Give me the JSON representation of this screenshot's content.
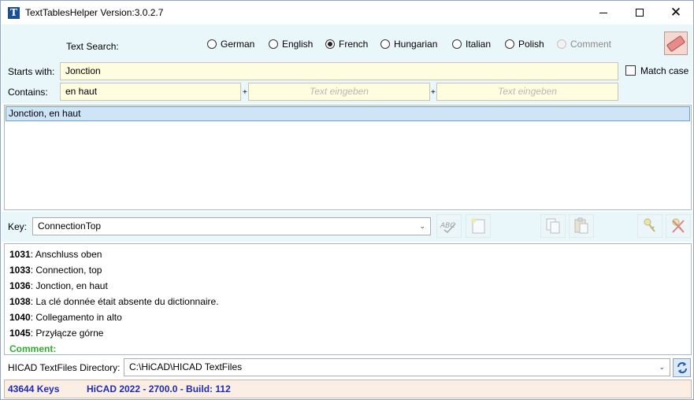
{
  "window": {
    "title": "TextTablesHelper Version:3.0.2.7",
    "app_icon_letter": "T"
  },
  "search": {
    "label": "Text Search:",
    "languages": [
      {
        "label": "German",
        "selected": false,
        "enabled": true
      },
      {
        "label": "English",
        "selected": false,
        "enabled": true
      },
      {
        "label": "French",
        "selected": true,
        "enabled": true
      },
      {
        "label": "Hungarian",
        "selected": false,
        "enabled": true
      },
      {
        "label": "Italian",
        "selected": false,
        "enabled": true
      },
      {
        "label": "Polish",
        "selected": false,
        "enabled": true
      },
      {
        "label": "Comment",
        "selected": false,
        "enabled": false
      }
    ],
    "starts_with_label": "Starts with:",
    "starts_with_value": "Jonction",
    "contains_label": "Contains:",
    "contains_value": "en haut",
    "plus": "+",
    "extra_placeholder_1": "Text eingeben",
    "extra_placeholder_2": "Text eingeben",
    "match_case_label": "Match case",
    "match_case_checked": false
  },
  "results": {
    "items": [
      "Jonction, en haut"
    ]
  },
  "key": {
    "label": "Key:",
    "value": "ConnectionTop"
  },
  "translations": [
    {
      "id": "1031",
      "text": ": Anschluss oben"
    },
    {
      "id": "1033",
      "text": ": Connection, top"
    },
    {
      "id": "1036",
      "text": ": Jonction, en haut"
    },
    {
      "id": "1038",
      "text": ": La clé donnée était absente du dictionnaire."
    },
    {
      "id": "1040",
      "text": ": Collegamento in alto"
    },
    {
      "id": "1045",
      "text": ": Przyłącze górne"
    }
  ],
  "comment_label": "Comment:",
  "directory": {
    "label": "HICAD TextFiles Directory:",
    "value": "C:\\HiCAD\\HICAD TextFiles"
  },
  "status": {
    "keys": "43644 Keys",
    "build": "HiCAD 2022 - 2700.0 - Build: 112"
  },
  "colors": {
    "panel_bg": "#eaf7fa",
    "field_bg": "#fffde0",
    "status_text": "#1f2bb8",
    "comment": "#2db02d",
    "selection": "#cde5f6"
  },
  "icons": [
    "app-icon",
    "minimize-icon",
    "maximize-icon",
    "close-icon",
    "eraser-icon",
    "spellcheck-icon",
    "new-note-icon",
    "copy-icon",
    "paste-icon",
    "key-icon",
    "delete-key-icon",
    "refresh-icon"
  ]
}
